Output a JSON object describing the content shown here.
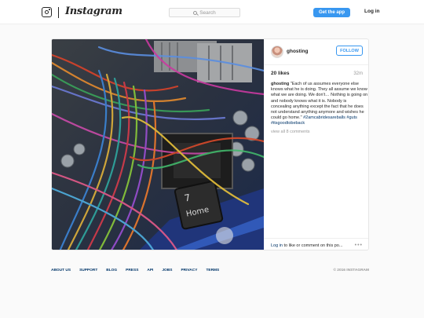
{
  "header": {
    "wordmark": "Instagram",
    "search_placeholder": "Search",
    "get_app": "Get the app",
    "login": "Log in"
  },
  "post": {
    "username": "ghosting",
    "follow": "FOLLOW",
    "likes": "20 likes",
    "time": "32m",
    "caption_user": "ghosting",
    "caption_text": " \"Each of us assumes everyone else knows what he is doing. They all assume we know what we are doing. We don't… Nothing is going on and nobody knows what it is. Nobody is concealing anything except the fact that he does not understand anything anymore and wishes he could go home.\" ",
    "caption_tags": "#2amcabridesareballs #guts #itsgoodtobeback",
    "view_all": "view all 8 comments",
    "login_link": "Log in",
    "login_rest": " to like or comment on this po...",
    "more": "•••",
    "photo_keys": [
      "7",
      "Home"
    ]
  },
  "footer": {
    "links": [
      "ABOUT US",
      "SUPPORT",
      "BLOG",
      "PRESS",
      "API",
      "JOBS",
      "PRIVACY",
      "TERMS"
    ],
    "copyright": "© 2016 INSTAGRAM"
  },
  "colors": {
    "accent": "#3897f0",
    "link": "#003569",
    "muted": "#999999"
  }
}
